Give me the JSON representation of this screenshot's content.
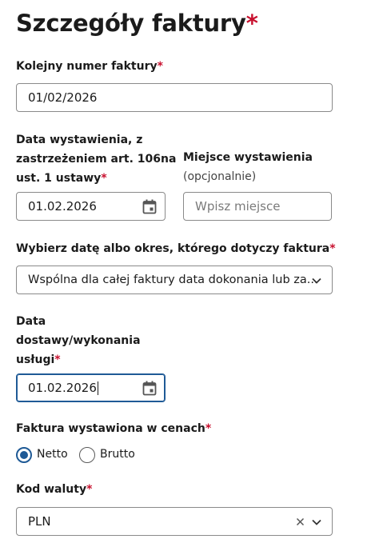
{
  "page": {
    "title": "Szczegóły faktury",
    "required_mark": "*"
  },
  "invoice_number": {
    "label": "Kolejny numer faktury",
    "value": "01/02/2026"
  },
  "issue_date": {
    "label_line1": "Data wystawienia, z",
    "label_line2": "zastrzeżeniem art. 106na",
    "label_line3": "ust. 1 ustawy",
    "value": "01.02.2026",
    "icon": "calendar-icon"
  },
  "issue_place": {
    "label": "Miejsce wystawienia",
    "optional": "(opcjonalnie)",
    "placeholder": "Wpisz miejsce"
  },
  "date_scope": {
    "label": "Wybierz datę albo okres, którego dotyczy faktura",
    "selected": "Wspólna dla całej faktury data dokonania lub za...",
    "icon": "chevron-down-icon"
  },
  "delivery_date": {
    "label_line1": "Data",
    "label_line2": "dostawy/wykonania",
    "label_line3": "usługi",
    "value": "01.02.2026",
    "icon": "calendar-icon"
  },
  "price_type": {
    "label": "Faktura wystawiona w cenach",
    "options": [
      {
        "label": "Netto",
        "selected": true
      },
      {
        "label": "Brutto",
        "selected": false
      }
    ]
  },
  "currency": {
    "label": "Kod waluty",
    "value": "PLN"
  },
  "colors": {
    "required": "#c8102e",
    "accent": "#1f5a96",
    "border": "#8a8a8a"
  }
}
